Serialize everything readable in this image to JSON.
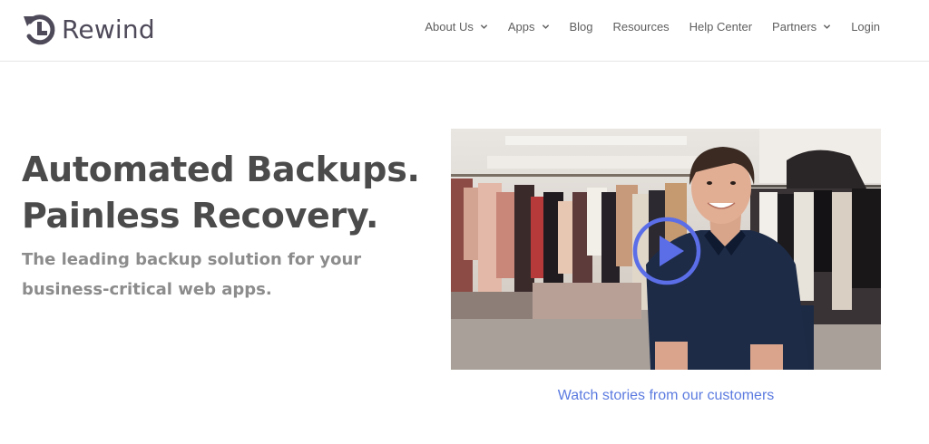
{
  "header": {
    "logo_text": "Rewind",
    "logo_icon": "rewind-clock-icon",
    "nav": [
      {
        "label": "About Us",
        "dropdown": true
      },
      {
        "label": "Apps",
        "dropdown": true
      },
      {
        "label": "Blog",
        "dropdown": false
      },
      {
        "label": "Resources",
        "dropdown": false
      },
      {
        "label": "Help Center",
        "dropdown": false
      },
      {
        "label": "Partners",
        "dropdown": true
      },
      {
        "label": "Login",
        "dropdown": false
      }
    ]
  },
  "hero": {
    "headline_line1": "Automated Backups.",
    "headline_line2": "Painless Recovery.",
    "sub_line1": "The leading backup solution for your",
    "sub_line2": "business-critical web apps."
  },
  "video": {
    "play_icon": "play-icon",
    "caption": "Watch stories from our customers"
  },
  "colors": {
    "brand": "#4f4a5a",
    "accent": "#5c7be0",
    "play": "#5b6ee8",
    "headline": "#4b4b4b",
    "subline": "#8c8c8c"
  }
}
